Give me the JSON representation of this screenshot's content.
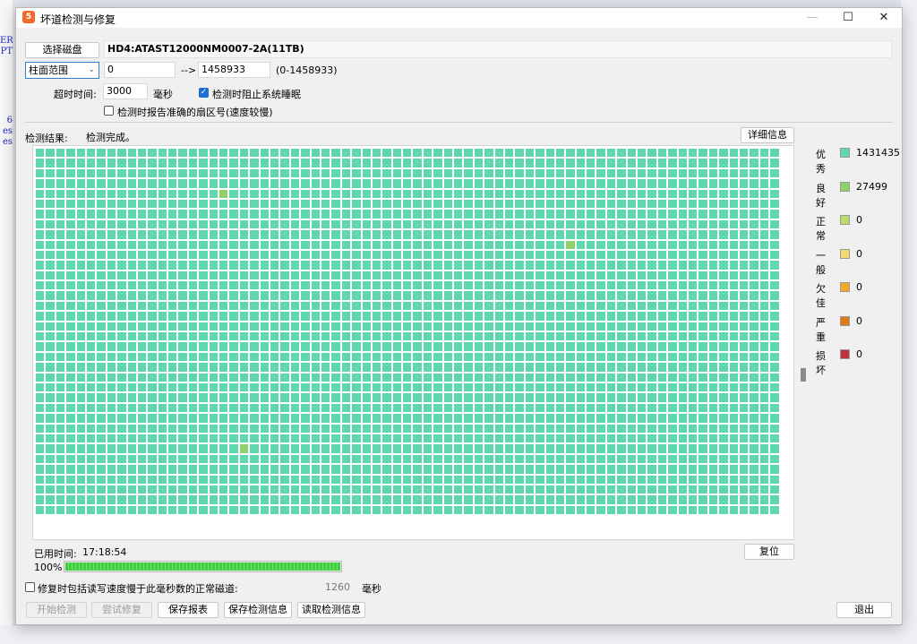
{
  "background": {
    "snippets": [
      "ER",
      "PT",
      "6",
      "es",
      "es"
    ]
  },
  "window": {
    "title": "坏道检测与修复",
    "icon_glyph": "5",
    "controls": {
      "minimize": "—",
      "maximize": "☐",
      "close": "✕"
    }
  },
  "disk": {
    "select_button": "选择磁盘",
    "name": "HD4:ATAST12000NM0007-2A(11TB)"
  },
  "range": {
    "mode": "柱面范围",
    "start": "0",
    "arrow": "-->",
    "end": "1458933",
    "bounds": "(0-1458933)"
  },
  "timeout": {
    "label": "超时时间:",
    "value": "3000",
    "unit": "毫秒"
  },
  "options": {
    "prevent_sleep": {
      "label": "检测时阻止系统睡眠",
      "checked": true
    },
    "accurate_sector": {
      "label": "检测时报告准确的扇区号(速度较慢)",
      "checked": false
    }
  },
  "result": {
    "label": "检测结果:",
    "status": "检测完成。",
    "details_button": "详细信息"
  },
  "grid": {
    "columns": 73,
    "rows": 36,
    "default_state": "excellent",
    "good_cells": [
      [
        4,
        18
      ],
      [
        9,
        52
      ],
      [
        29,
        20
      ]
    ]
  },
  "legend": [
    {
      "label": "优秀",
      "count": "1431435",
      "color": "#5fd8ad"
    },
    {
      "label": "良好",
      "count": "27499",
      "color": "#8fd16a"
    },
    {
      "label": "正常",
      "count": "0",
      "color": "#bddb6a"
    },
    {
      "label": "一般",
      "count": "0",
      "color": "#f3d873"
    },
    {
      "label": "欠佳",
      "count": "0",
      "color": "#f3a92a"
    },
    {
      "label": "严重",
      "count": "0",
      "color": "#e07a12"
    },
    {
      "label": "损坏",
      "count": "0",
      "color": "#c0343d"
    }
  ],
  "elapsed": {
    "label": "已用时间:",
    "value": "17:18:54",
    "reset_button": "复位"
  },
  "progress": {
    "label": "100%",
    "value": 1.0
  },
  "repair_option": {
    "label": "修复时包括读写速度慢于此毫秒数的正常磁道:",
    "checked": false,
    "value": "1260",
    "unit": "毫秒"
  },
  "actions": {
    "start": "开始检测",
    "repair": "尝试修复",
    "save_report": "保存报表",
    "save_info": "保存检测信息",
    "load_info": "读取检测信息",
    "exit": "退出"
  }
}
